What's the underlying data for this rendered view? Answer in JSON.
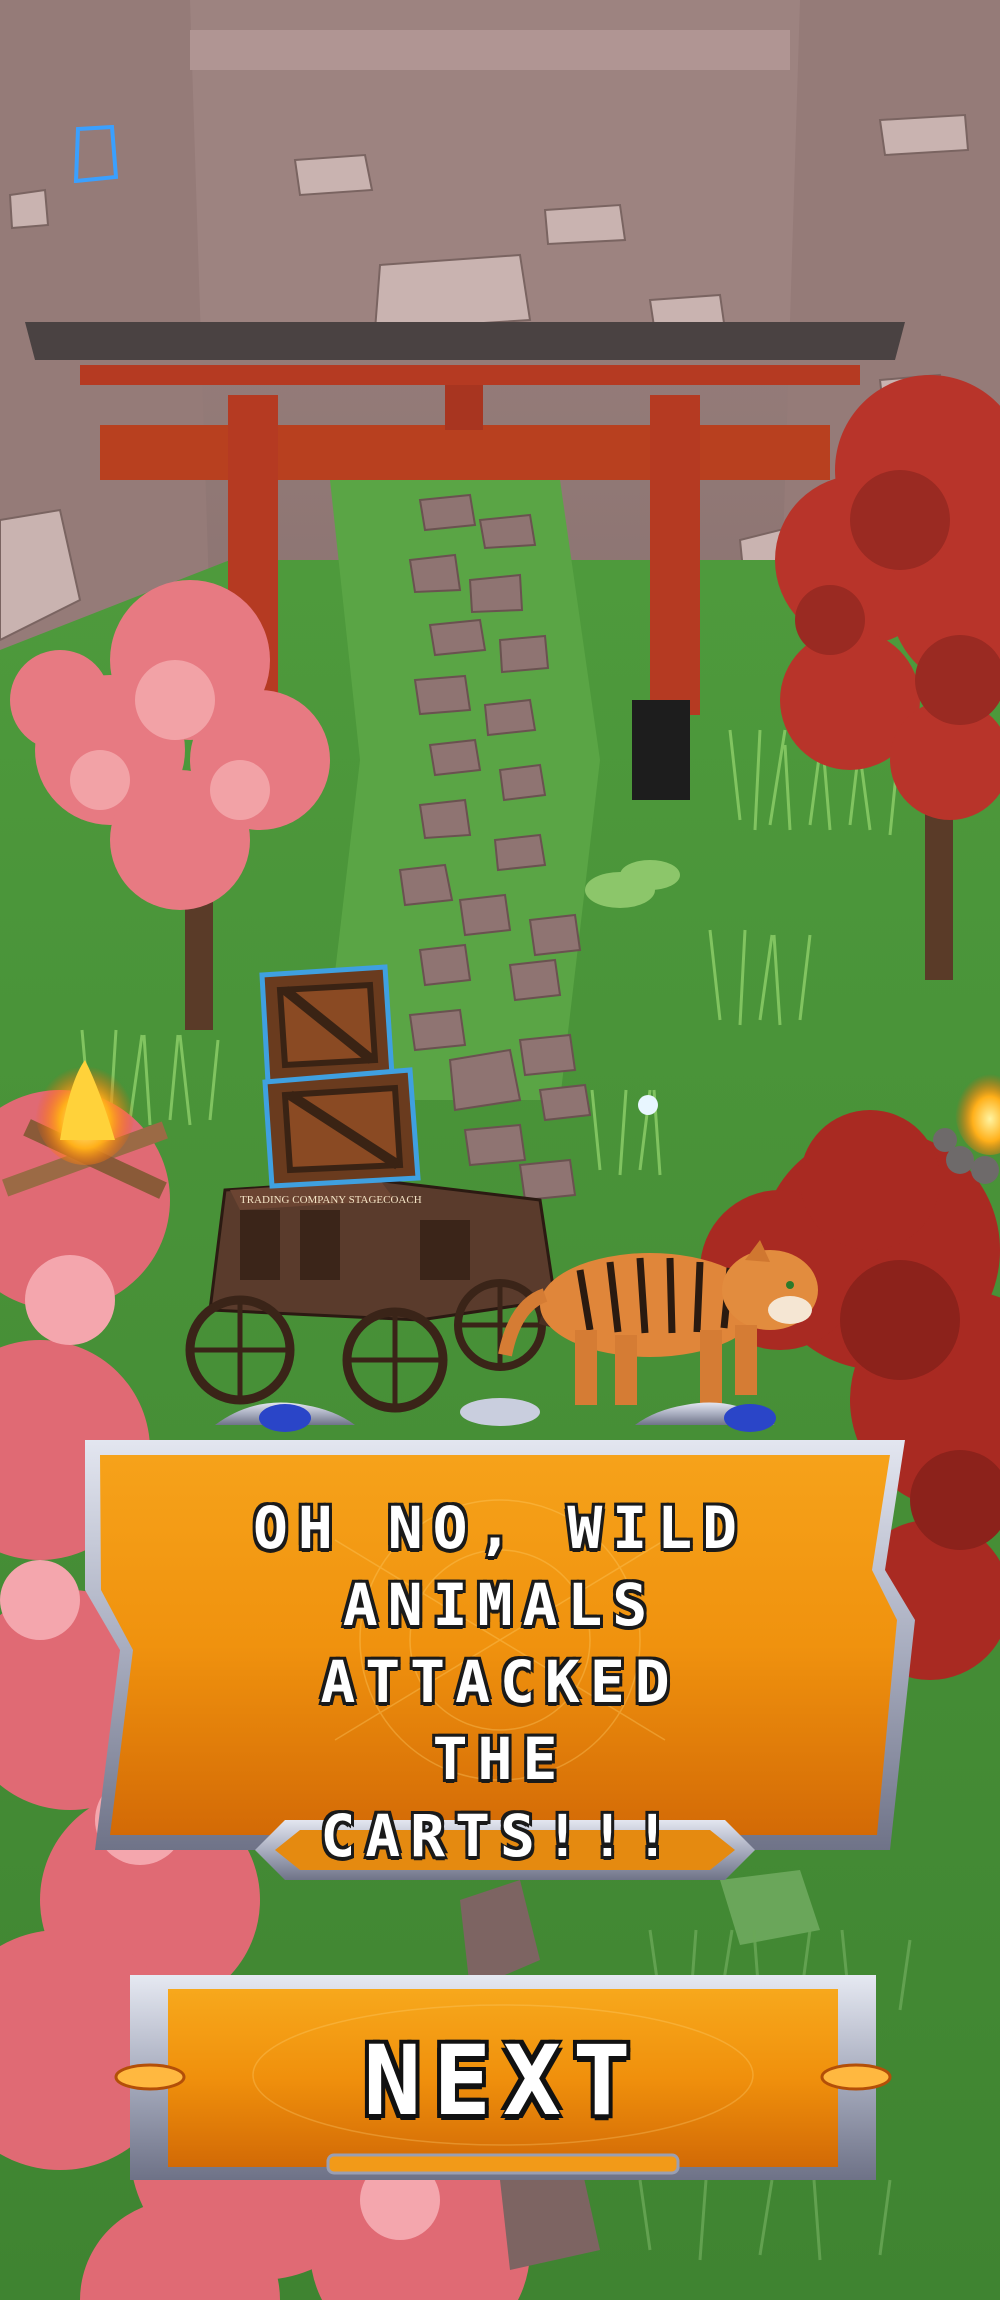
{
  "dialog": {
    "message": "Oh no, wild animals attacked the carts!!!"
  },
  "next_button": {
    "label": "Next"
  },
  "stagecoach": {
    "sign": "TRADING COMPANY STAGECOACH"
  },
  "colors": {
    "panel_orange": "#f0920e",
    "frame_silver": "#b8bccb",
    "grass": "#4a8f3a",
    "torii_red": "#b53a22"
  },
  "icons": {
    "hud": "hexagon-outline-icon"
  }
}
